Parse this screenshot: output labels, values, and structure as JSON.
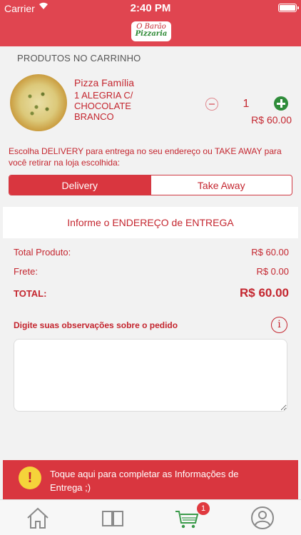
{
  "status_bar": {
    "carrier": "Carrier",
    "time": "2:40 PM"
  },
  "header": {
    "logo_line1": "O Barão",
    "logo_line2": "Pizzaria"
  },
  "cart": {
    "section_title": "PRODUTOS NO CARRINHO",
    "item": {
      "name": "Pizza Família",
      "description": "1 ALEGRIA C/ CHOCOLATE BRANCO",
      "quantity": "1",
      "price": "R$ 60.00"
    }
  },
  "delivery": {
    "instructions": "Escolha DELIVERY para entrega no seu endereço ou TAKE AWAY para você retirar na loja escolhida:",
    "options": [
      "Delivery",
      "Take Away"
    ],
    "selected": "Delivery",
    "address_prompt": "Informe o ENDEREÇO de ENTREGA"
  },
  "summary": {
    "product_label": "Total Produto:",
    "product_value": "R$ 60.00",
    "freight_label": "Frete:",
    "freight_value": "R$ 0.00",
    "total_label": "TOTAL:",
    "total_value": "R$ 60.00"
  },
  "notes": {
    "label": "Digite suas observações sobre o pedido",
    "value": ""
  },
  "alert": {
    "text": "Toque aqui para completar as Informações de Entrega ;)"
  },
  "tabbar": {
    "tabs": [
      "home-icon",
      "menu-book-icon",
      "cart-icon",
      "profile-icon"
    ],
    "cart_badge": "1",
    "active_tab": "cart-icon"
  },
  "colors": {
    "brand_red": "#e04550",
    "text_red": "#c4262f",
    "green": "#2f8c3a",
    "alert_yellow": "#f5d33a"
  }
}
